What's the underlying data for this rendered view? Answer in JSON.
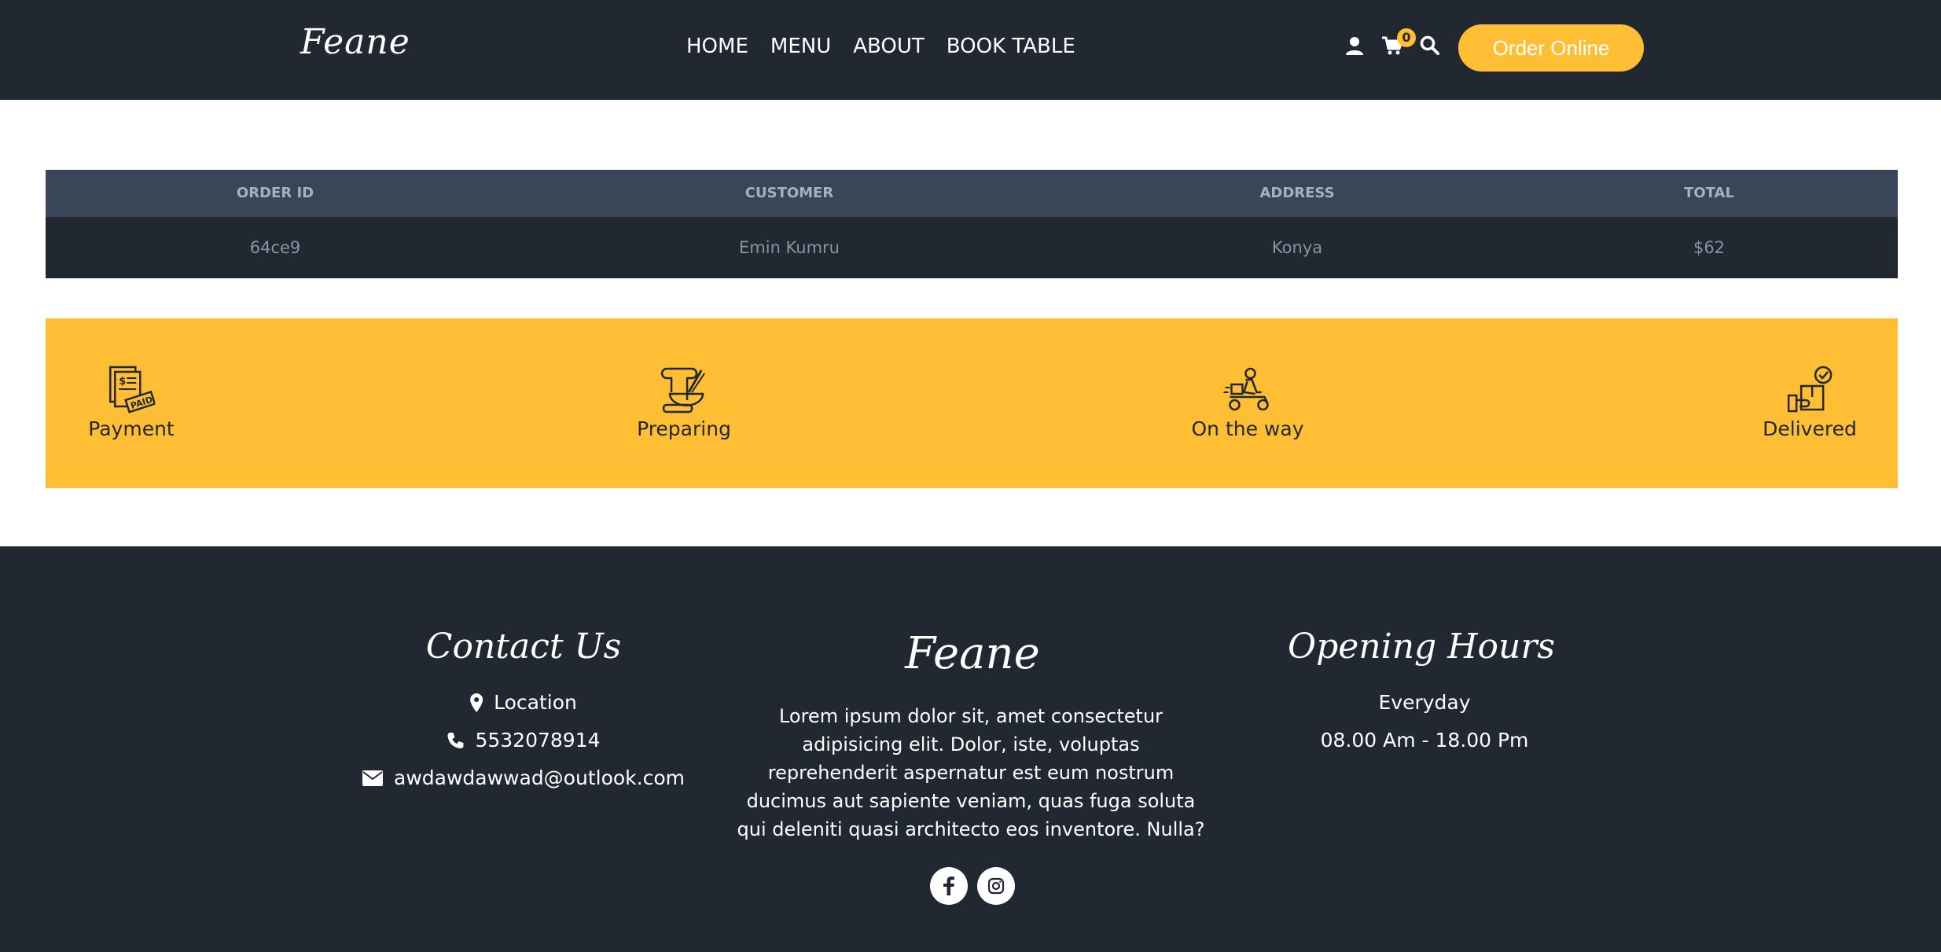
{
  "header": {
    "brand": "Feane",
    "nav": [
      "HOME",
      "MENU",
      "ABOUT",
      "BOOK TABLE"
    ],
    "icons": [
      "user-icon",
      "cart-icon",
      "search-icon"
    ],
    "cart_count": "0",
    "order_button": "Order Online"
  },
  "order_table": {
    "columns": [
      "ORDER ID",
      "CUSTOMER",
      "ADDRESS",
      "TOTAL"
    ],
    "rows": [
      [
        "64ce9",
        "Emin Kumru",
        "Konya",
        "$62"
      ]
    ]
  },
  "status_steps": [
    {
      "label": "Payment",
      "icon": "paid-receipt-icon"
    },
    {
      "label": "Preparing",
      "icon": "cooking-icon"
    },
    {
      "label": "On the way",
      "icon": "delivery-scooter-icon"
    },
    {
      "label": "Delivered",
      "icon": "delivered-package-icon"
    }
  ],
  "footer": {
    "contact": {
      "title": "Contact Us",
      "location": "Location",
      "phone": "5532078914",
      "email": "awdawdawwad@outlook.com"
    },
    "about": {
      "brand": "Feane",
      "text": "Lorem ipsum dolor sit, amet consectetur adipisicing elit. Dolor, iste, voluptas reprehenderit aspernatur est eum nostrum ducimus aut sapiente veniam, quas fuga soluta qui deleniti quasi architecto eos inventore. Nulla?",
      "social": [
        "facebook-icon",
        "instagram-icon"
      ]
    },
    "hours": {
      "title": "Opening Hours",
      "days": "Everyday",
      "time": "08.00 Am - 18.00 Pm"
    }
  },
  "colors": {
    "dark": "#222831",
    "accent": "#ffbe33",
    "table_header": "#3a4558"
  }
}
